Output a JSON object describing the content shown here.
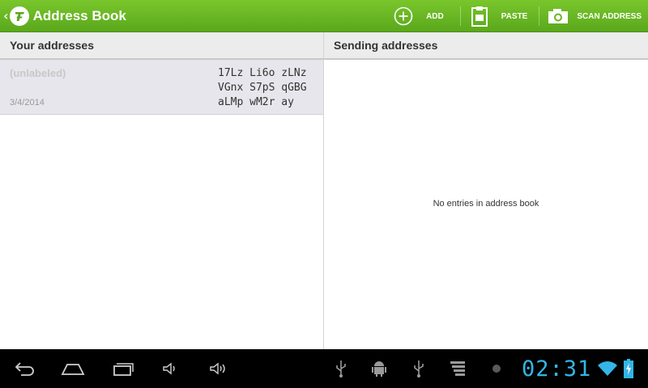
{
  "app": {
    "title": "Address Book",
    "accent_color": "#6cb524",
    "up_icon": "chevron-left-icon",
    "logo_icon": "app-logo-icon"
  },
  "actions": [
    {
      "label": "ADD",
      "icon": "add-circle-icon"
    },
    {
      "label": "PASTE",
      "icon": "clipboard-icon"
    },
    {
      "label": "SCAN ADDRESS",
      "icon": "camera-icon"
    }
  ],
  "your_addresses": {
    "header": "Your addresses",
    "items": [
      {
        "label": "(unlabeled)",
        "date": "3/4/2014",
        "address_lines": [
          "17Lz Li6o zLNz",
          "VGnx S7pS qGBG",
          "aLMp wM2r ay"
        ]
      }
    ]
  },
  "sending_addresses": {
    "header": "Sending addresses",
    "empty_message": "No entries in address book"
  },
  "system_bar": {
    "clock": "02:31",
    "clock_color": "#33b5e5",
    "nav_buttons": [
      "back-icon",
      "home-icon",
      "recent-apps-icon",
      "volume-down-icon",
      "volume-up-icon"
    ],
    "status_icons": [
      "usb-icon",
      "android-debug-icon",
      "usb-icon",
      "storage-icon",
      "dot-icon",
      "wifi-icon",
      "battery-charging-icon"
    ]
  }
}
